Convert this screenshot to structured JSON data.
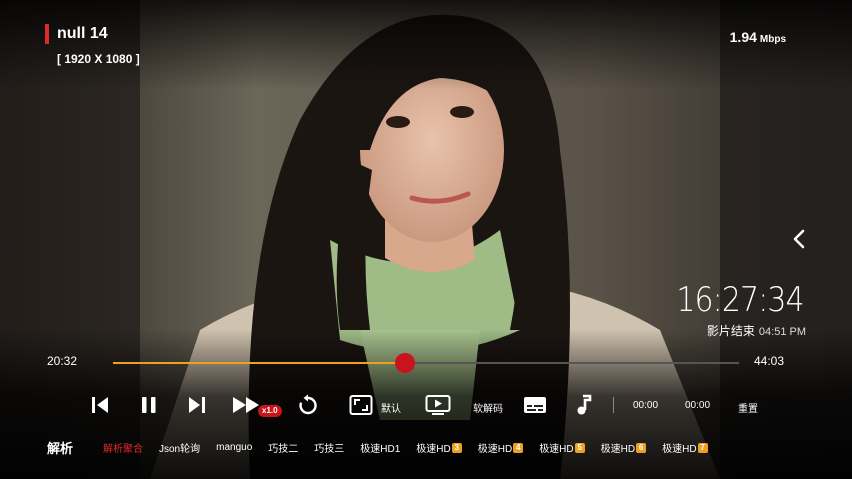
{
  "video": {
    "title": "null 14",
    "resolution": "[ 1920 X 1080 ]",
    "net_speed": "1.94",
    "net_speed_unit": "Mbps"
  },
  "clock": {
    "time": "16:27:34",
    "end_label": "影片结束",
    "end_time": "04:51 PM"
  },
  "progress": {
    "current": "20:32",
    "total": "44:03",
    "fraction": 0.466
  },
  "controls": {
    "speed_badge": "x1.0",
    "aspect_label": "默认",
    "decoder_label": "软解码",
    "skip_start": "00:00",
    "skip_end": "00:00",
    "reset_label": "重置"
  },
  "parse": {
    "label": "解析",
    "sources": [
      {
        "name": "解析聚合",
        "badge": ""
      },
      {
        "name": "Json轮询",
        "badge": ""
      },
      {
        "name": "manguo",
        "badge": ""
      },
      {
        "name": "巧技二",
        "badge": ""
      },
      {
        "name": "巧技三",
        "badge": ""
      },
      {
        "name": "极速HD1",
        "badge": ""
      },
      {
        "name": "极速HD",
        "badge": "3"
      },
      {
        "name": "极速HD",
        "badge": "4"
      },
      {
        "name": "极速HD",
        "badge": "5"
      },
      {
        "name": "极速HD",
        "badge": "6"
      },
      {
        "name": "极速HD",
        "badge": "7"
      }
    ],
    "active_index": 0
  },
  "colors": {
    "accent_red": "#c8141c",
    "progress_fill": "#f0a020",
    "active_source": "#e0282e"
  },
  "icons": [
    "skip-previous-icon",
    "pause-icon",
    "skip-next-icon",
    "fast-forward-icon",
    "replay-icon",
    "aspect-ratio-icon",
    "decoder-icon",
    "subtitles-icon",
    "music-note-icon",
    "back-chevron-icon"
  ]
}
